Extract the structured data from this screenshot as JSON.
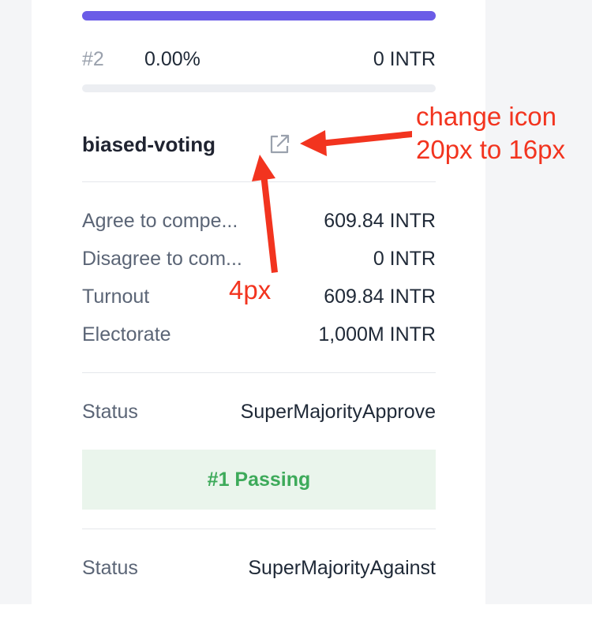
{
  "previous_option": {
    "rank": "#2",
    "percentage": "0.00%",
    "votes": "0 INTR",
    "progress_fraction": 0
  },
  "top_bar": {
    "progress_fraction": 1
  },
  "referendum": {
    "title": "biased-voting",
    "link_icon": "external-link-icon",
    "stats": [
      {
        "label": "Agree to compe...",
        "value": "609.84 INTR"
      },
      {
        "label": "Disagree to com...",
        "value": "0 INTR"
      },
      {
        "label": "Turnout",
        "value": "609.84 INTR"
      },
      {
        "label": "Electorate",
        "value": "1,000M INTR"
      }
    ]
  },
  "status_rows": [
    {
      "label": "Status",
      "value": "SuperMajorityApprove"
    },
    {
      "label": "Status",
      "value": "SuperMajorityAgainst"
    }
  ],
  "passing_badge": "#1 Passing",
  "annotations": {
    "change_icon_line1": "change icon",
    "change_icon_line2": "20px to 16px",
    "spacing": "4px",
    "color": "#f2341f"
  },
  "colors": {
    "accent": "#6b5ce7",
    "passing_bg": "#eaf5ec",
    "passing_text": "#3daa5a"
  }
}
